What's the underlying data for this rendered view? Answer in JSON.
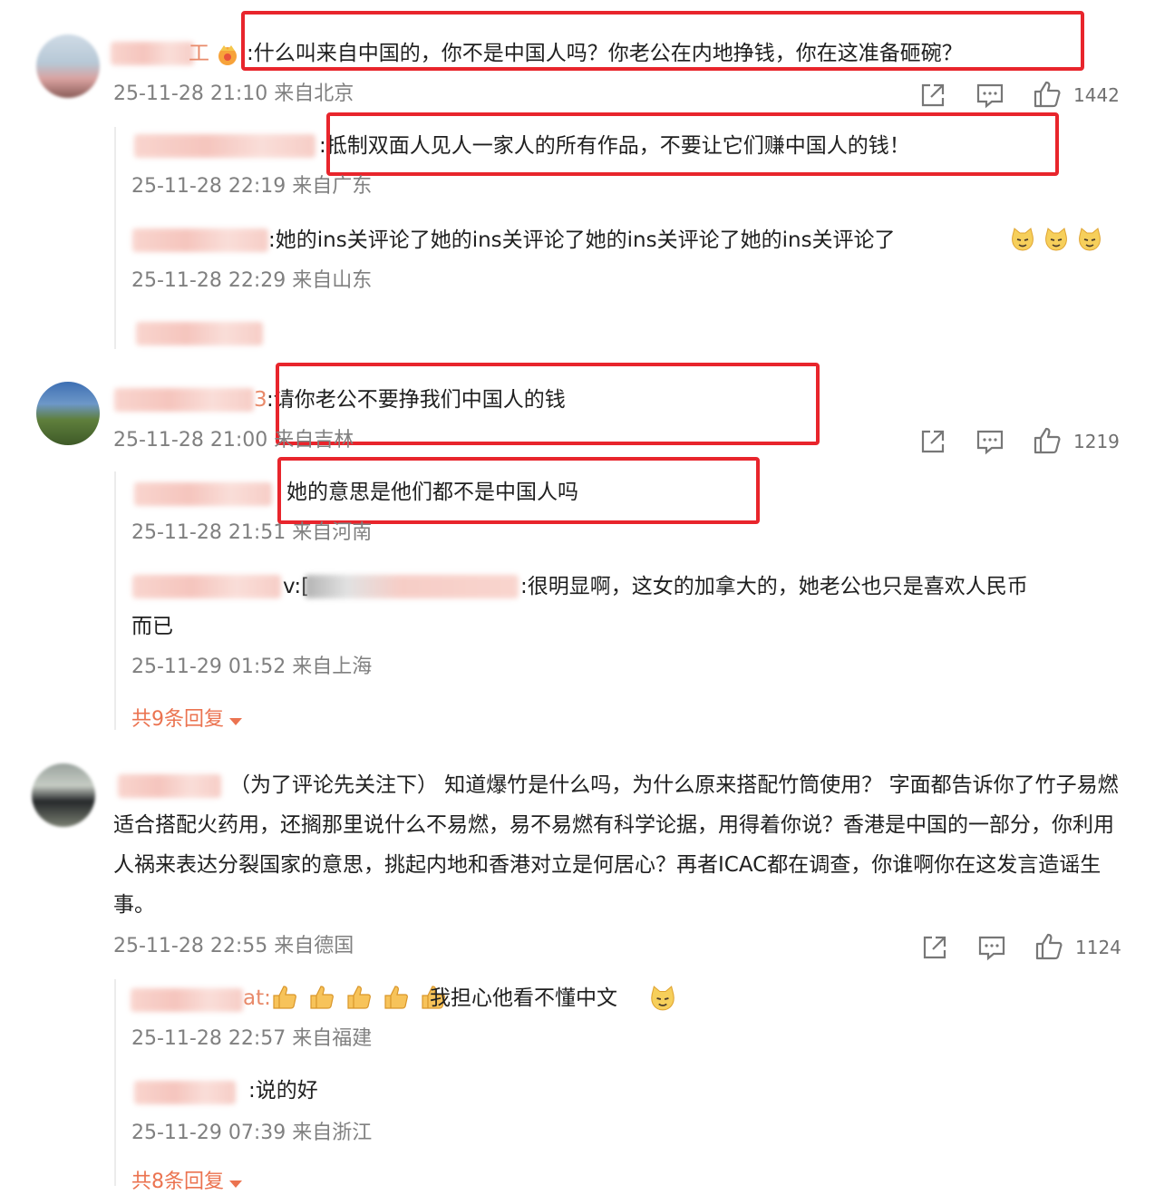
{
  "colors": {
    "highlight_box": "#e8252c",
    "reply_toggle": "#eb7350",
    "meta_text": "#808080"
  },
  "comments": [
    {
      "username_suffix": "工",
      "text": ":什么叫来自中国的，你不是中国人吗？你老公在内地挣钱，你在这准备砸碗？",
      "meta": "25-11-28 21:10 来自北京",
      "likes": "1442",
      "replies": [
        {
          "text": ":抵制双面人见人一家人的所有作品，不要让它们赚中国人的钱！",
          "meta": "25-11-28 22:19 来自广东"
        },
        {
          "text": ":她的ins关评论了她的ins关评论了她的ins关评论了她的ins关评论了",
          "emoji_count": 3,
          "meta": "25-11-28 22:29 来自山东"
        }
      ]
    },
    {
      "username_suffix": "3",
      "text": ":请你老公不要挣我们中国人的钱",
      "meta": "25-11-28 21:00 来自吉林",
      "likes": "1219",
      "replies": [
        {
          "text": "她的意思是他们都不是中国人吗",
          "meta": "25-11-28 21:51 来自河南"
        },
        {
          "text_prefix": "v:[",
          "text": ":很明显啊，这女的加拿大的，她老公也只是喜欢人民币",
          "text_line2": "而已",
          "meta": "25-11-29 01:52 来自上海"
        }
      ],
      "more_replies": "共9条回复"
    },
    {
      "text": "（为了评论先关注下） 知道爆竹是什么吗，为什么原来搭配竹筒使用？ 字面都告诉你了竹子易燃适合搭配火药用，还搁那里说什么不易燃，易不易燃有科学论据，用得着你说？香港是中国的一部分，你利用人祸来表达分裂国家的意思，挑起内地和香港对立是何居心？再者ICAC都在调查，你谁啊你在这发言造谣生事。",
      "meta": "25-11-28 22:55 来自德国",
      "likes": "1124",
      "replies": [
        {
          "text_prefix": "at:",
          "text": "我担心他看不懂中文",
          "meta": "25-11-28 22:57 来自福建"
        },
        {
          "text": ":说的好",
          "meta": "25-11-29 07:39 来自浙江"
        }
      ],
      "more_replies": "共8条回复"
    }
  ],
  "icons": [
    "share-icon",
    "comment-icon",
    "like-icon"
  ]
}
